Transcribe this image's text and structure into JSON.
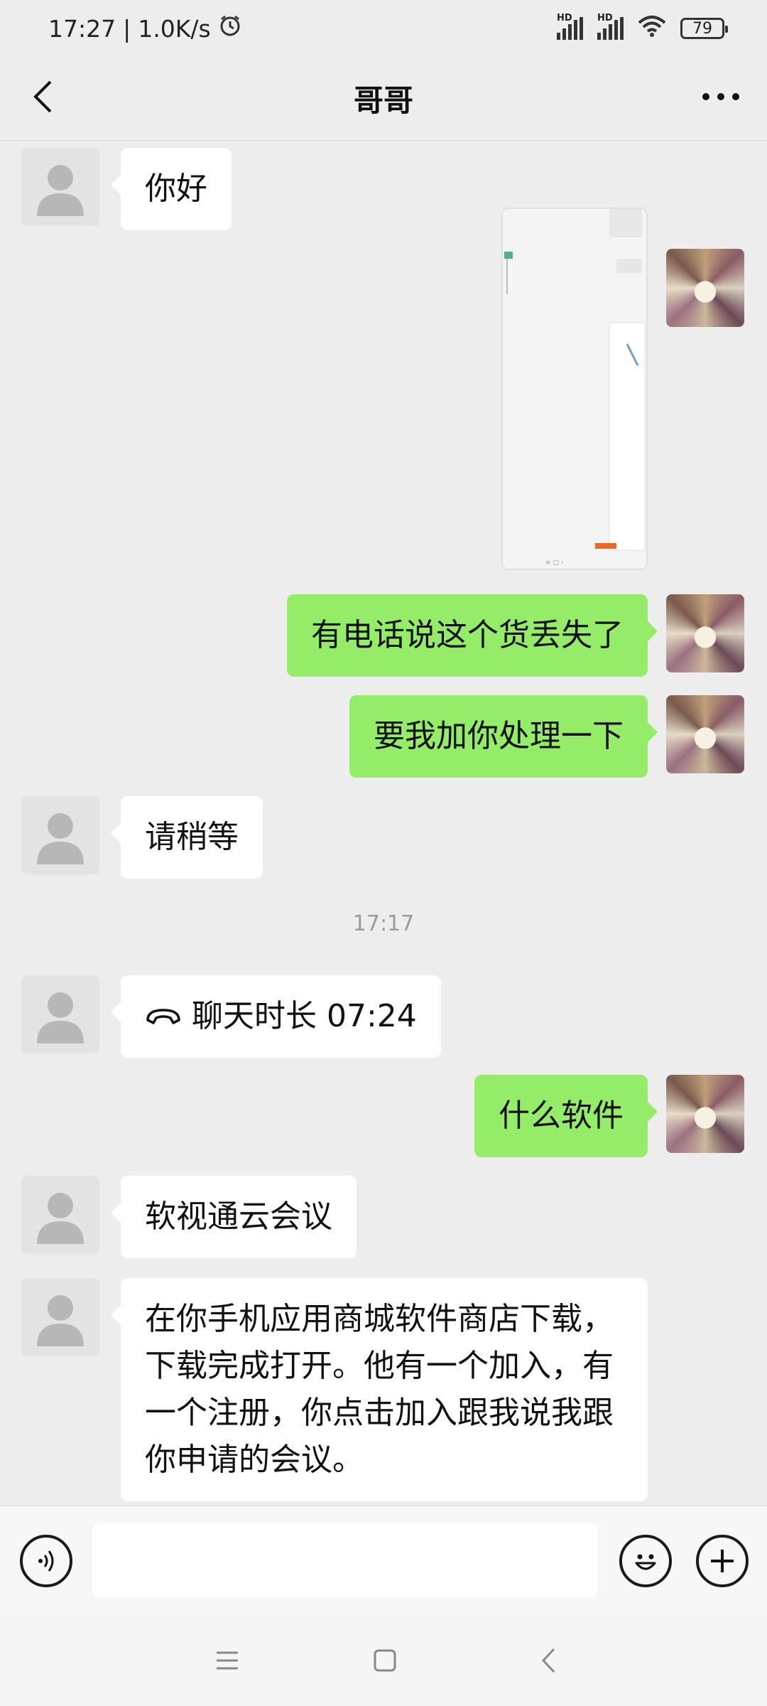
{
  "status_bar": {
    "time": "17:27",
    "network_speed": "1.0K/s",
    "alarm_icon": "alarm-clock-icon",
    "signal1_label": "HD",
    "signal2_label": "HD",
    "battery": "79"
  },
  "header": {
    "title": "哥哥",
    "back_icon": "chevron-left-icon",
    "more_icon": "more-dots-icon"
  },
  "messages": [
    {
      "side": "in",
      "text": "你好"
    },
    {
      "side": "out",
      "type": "image",
      "description": "screenshot-thumbnail"
    },
    {
      "side": "out",
      "text": "有电话说这个货丢失了"
    },
    {
      "side": "out",
      "text": "要我加你处理一下"
    },
    {
      "side": "in",
      "text": "请稍等"
    },
    {
      "type": "timestamp",
      "text": "17:17"
    },
    {
      "side": "in",
      "type": "call",
      "text": "聊天时长 07:24"
    },
    {
      "side": "out",
      "text": "什么软件"
    },
    {
      "side": "in",
      "text": "软视通云会议"
    },
    {
      "side": "in",
      "text": "在你手机应用商城软件商店下载，下载完成打开。他有一个加入，有一个注册，你点击加入跟我说我跟你申请的会议。"
    }
  ],
  "input_bar": {
    "voice_icon": "voice-icon",
    "input_value": "",
    "emoji_icon": "emoji-icon",
    "plus_icon": "plus-icon"
  },
  "nav_bar": {
    "menu_icon": "menu-icon",
    "home_icon": "home-square-icon",
    "back_icon": "back-triangle-icon"
  },
  "colors": {
    "background": "#EDEDED",
    "bubble_out": "#95EC69",
    "bubble_in": "#FFFFFF"
  }
}
